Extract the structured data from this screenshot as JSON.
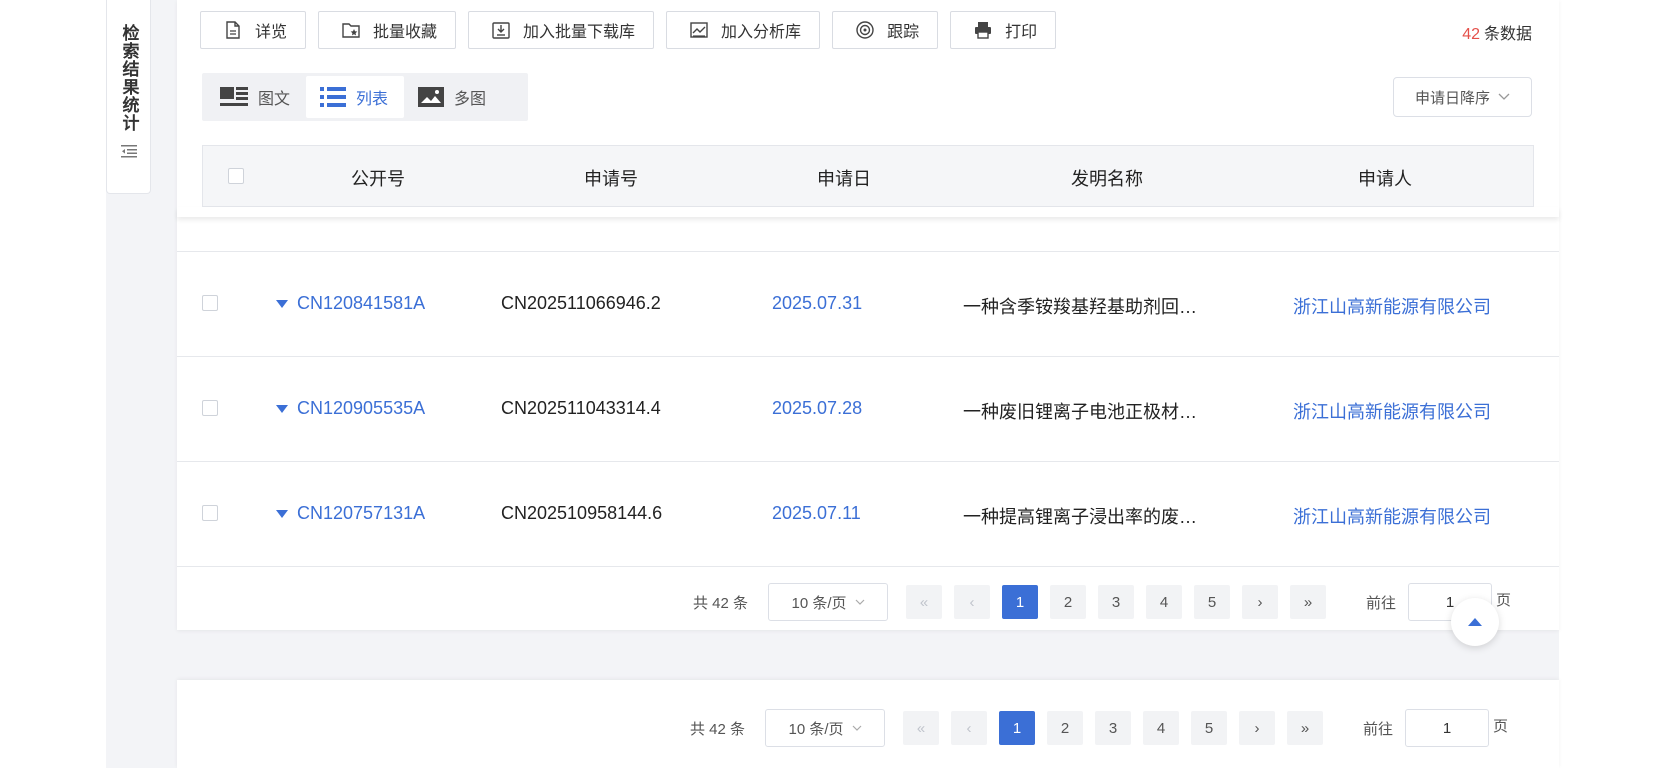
{
  "toolbar": {
    "buttons": [
      {
        "label": "详览",
        "icon": "document-icon"
      },
      {
        "label": "批量收藏",
        "icon": "folder-star-icon"
      },
      {
        "label": "加入批量下载库",
        "icon": "download-box-icon"
      },
      {
        "label": "加入分析库",
        "icon": "chart-icon"
      },
      {
        "label": "跟踪",
        "icon": "radar-icon"
      },
      {
        "label": "打印",
        "icon": "printer-icon"
      }
    ],
    "count_number": "42",
    "count_suffix": "条数据"
  },
  "side_tab": {
    "label": "检索结果统计"
  },
  "view_switch": {
    "options": [
      {
        "label": "图文",
        "icon": "image-text-icon"
      },
      {
        "label": "列表",
        "icon": "list-icon",
        "active": true
      },
      {
        "label": "多图",
        "icon": "gallery-icon"
      }
    ]
  },
  "sort": {
    "label": "申请日降序"
  },
  "table": {
    "headers": [
      "公开号",
      "申请号",
      "申请日",
      "发明名称",
      "申请人"
    ],
    "rows": [
      {
        "pub_no": "CN120841581A",
        "app_no": "CN202511066946.2",
        "app_date": "2025.07.31",
        "title": "一种含季铵羧基羟基助剂回…",
        "applicant": "浙江山高新能源有限公司"
      },
      {
        "pub_no": "CN120905535A",
        "app_no": "CN202511043314.4",
        "app_date": "2025.07.28",
        "title": "一种废旧锂离子电池正极材…",
        "applicant": "浙江山高新能源有限公司"
      },
      {
        "pub_no": "CN120757131A",
        "app_no": "CN202510958144.6",
        "app_date": "2025.07.11",
        "title": "一种提高锂离子浸出率的废…",
        "applicant": "浙江山高新能源有限公司"
      }
    ]
  },
  "pagination": {
    "total": "共 42 条",
    "page_size": "10 条/页",
    "pages": [
      "1",
      "2",
      "3",
      "4",
      "5"
    ],
    "first": "«",
    "prev": "‹",
    "next": "›",
    "last": "»",
    "goto_label": "前往",
    "goto_value": "1",
    "goto_unit": "页"
  },
  "colors": {
    "accent": "#3b6fd6",
    "count": "#e4504a"
  }
}
